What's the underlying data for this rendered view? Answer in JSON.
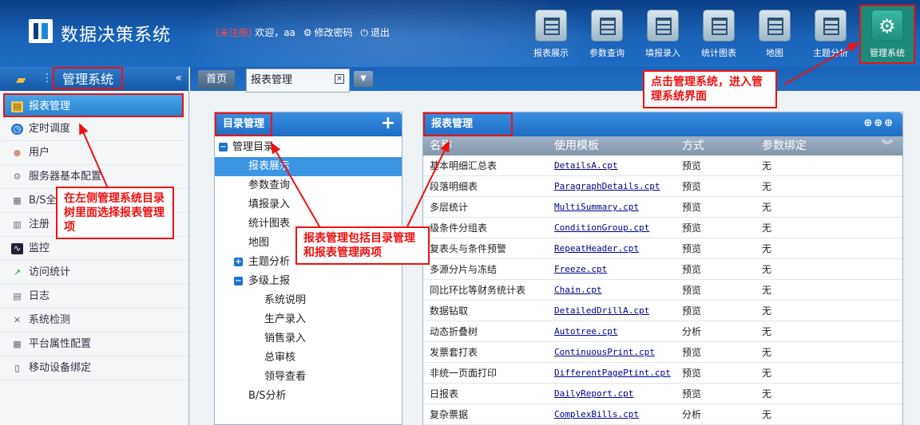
{
  "header": {
    "app_title": "数据决策系统",
    "unregistered": "(未注册)",
    "welcome": "欢迎，aa",
    "change_password": "修改密码",
    "logout": "退出",
    "tools": [
      {
        "label": "报表展示",
        "icon": "report-icon"
      },
      {
        "label": "参数查询",
        "icon": "query-icon"
      },
      {
        "label": "填报录入",
        "icon": "fill-icon"
      },
      {
        "label": "统计图表",
        "icon": "chart-icon"
      },
      {
        "label": "地图",
        "icon": "map-icon"
      },
      {
        "label": "主题分析",
        "icon": "theme-icon"
      },
      {
        "label": "管理系统",
        "icon": "gear-icon"
      }
    ]
  },
  "sidebar": {
    "title": "管理系统",
    "items": [
      {
        "label": "报表管理",
        "icon": "report-icon"
      },
      {
        "label": "定时调度",
        "icon": "clock-icon"
      },
      {
        "label": "用户",
        "icon": "user-icon"
      },
      {
        "label": "服务器基本配置",
        "icon": "gear-icon"
      },
      {
        "label": "B/S全",
        "icon": "database-icon"
      },
      {
        "label": "注册",
        "icon": "register-icon"
      },
      {
        "label": "监控",
        "icon": "monitor-icon"
      },
      {
        "label": "访问统计",
        "icon": "stats-icon"
      },
      {
        "label": "日志",
        "icon": "log-icon"
      },
      {
        "label": "系统检测",
        "icon": "tools-icon"
      },
      {
        "label": "平台属性配置",
        "icon": "platform-icon"
      },
      {
        "label": "移动设备绑定",
        "icon": "mobile-icon"
      }
    ]
  },
  "tabs": {
    "home": "首页",
    "report_tab": "报表管理",
    "close": "×",
    "dropdown": "▼"
  },
  "tree_panel": {
    "title": "目录管理",
    "add": "+",
    "nodes": [
      {
        "label": "管理目录",
        "toggle": "−"
      },
      {
        "label": "报表展示"
      },
      {
        "label": "参数查询"
      },
      {
        "label": "填报录入"
      },
      {
        "label": "统计图表"
      },
      {
        "label": "地图"
      },
      {
        "label": "主题分析",
        "toggle": "+"
      },
      {
        "label": "多级上报",
        "toggle": "−"
      },
      {
        "label": "系统说明"
      },
      {
        "label": "生产录入"
      },
      {
        "label": "销售录入"
      },
      {
        "label": "总审核"
      },
      {
        "label": "领导查看"
      },
      {
        "label": "B/S分析"
      }
    ]
  },
  "table_panel": {
    "title": "报表管理",
    "actions": "⊕⊕⊕",
    "columns": [
      "名称",
      "使用模板",
      "方式",
      "参数绑定"
    ],
    "collapse": "︾",
    "rows": [
      [
        "基本明细汇总表",
        "DetailsA.cpt",
        "预览",
        "无"
      ],
      [
        "段落明细表",
        "ParagraphDetails.cpt",
        "预览",
        "无"
      ],
      [
        "多层统计",
        "MultiSummary.cpt",
        "预览",
        "无"
      ],
      [
        "级条件分组表",
        "ConditionGroup.cpt",
        "预览",
        "无"
      ],
      [
        "复表头与条件预警",
        "RepeatHeader.cpt",
        "预览",
        "无"
      ],
      [
        "多源分片与冻结",
        "Freeze.cpt",
        "预览",
        "无"
      ],
      [
        "同比环比等财务统计表",
        "Chain.cpt",
        "预览",
        "无"
      ],
      [
        "数据钻取",
        "DetailedDrillA.cpt",
        "预览",
        "无"
      ],
      [
        "动态折叠树",
        "Autotree.cpt",
        "分析",
        "无"
      ],
      [
        "发票套打表",
        "ContinuousPrint.cpt",
        "预览",
        "无"
      ],
      [
        "非统一页面打印",
        "DifferentPagePtint.cpt",
        "预览",
        "无"
      ],
      [
        "日报表",
        "DailyReport.cpt",
        "预览",
        "无"
      ],
      [
        "复杂票据",
        "ComplexBills.cpt",
        "分析",
        "无"
      ]
    ]
  },
  "callouts": {
    "top_right": "点击管理系统，进入管理系统界面",
    "left": "在左侧管理系统目录树里面选择报表管理项",
    "middle": "报表管理包括目录管理和报表管理两项"
  },
  "colors": {
    "accent": "#1d6cc3",
    "annotation": "#ee1111",
    "selected": "#3c95e3"
  }
}
